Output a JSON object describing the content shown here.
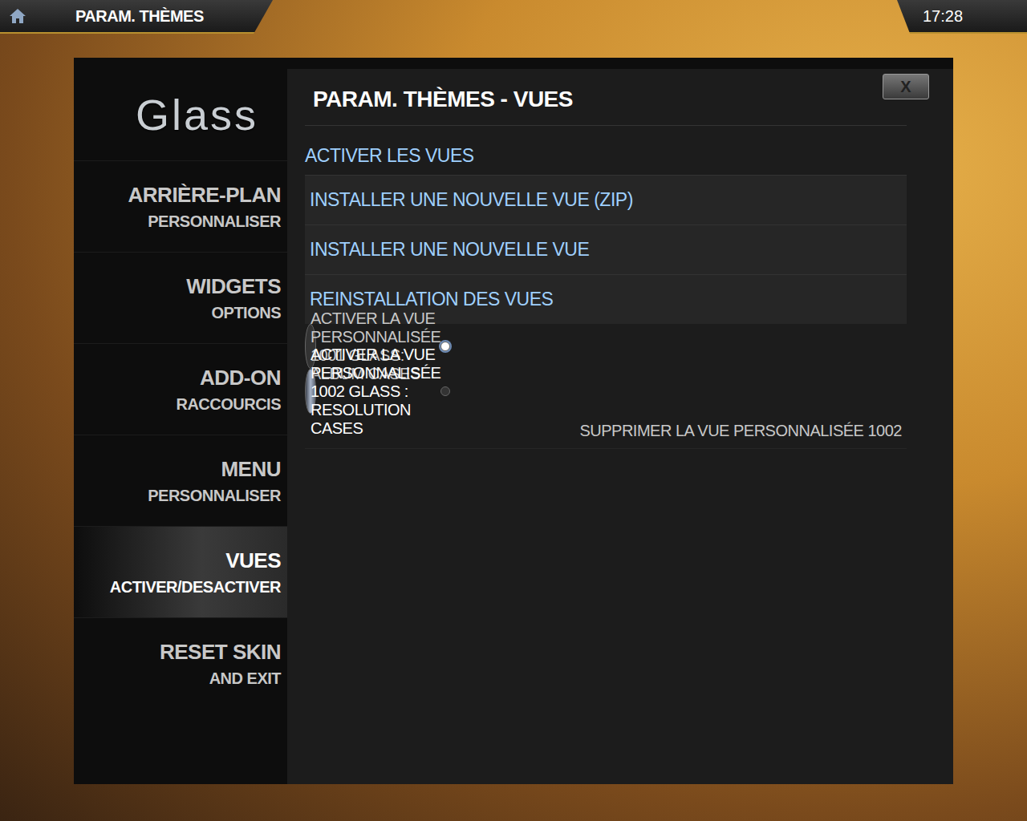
{
  "header": {
    "title": "PARAM. THÈMES",
    "clock": "17:28"
  },
  "dialog": {
    "logo": "Glass",
    "title": "PARAM. THÈMES - VUES",
    "close": "X"
  },
  "sidebar": {
    "items": [
      {
        "label": "ARRIÈRE-PLAN",
        "sub": "PERSONNALISER",
        "selected": false
      },
      {
        "label": "WIDGETS",
        "sub": "OPTIONS",
        "selected": false
      },
      {
        "label": "ADD-ON",
        "sub": "RACCOURCIS",
        "selected": false
      },
      {
        "label": "MENU",
        "sub": "PERSONNALISER",
        "selected": false
      },
      {
        "label": "VUES",
        "sub": "ACTIVER/DESACTIVER",
        "selected": true
      },
      {
        "label": "RESET SKIN",
        "sub": "AND EXIT",
        "selected": false
      }
    ]
  },
  "section": "ACTIVER LES VUES",
  "actions": [
    "INSTALLER UNE NOUVELLE VUE (ZIP)",
    "INSTALLER UNE NOUVELLE VUE",
    "REINSTALLATION DES VUES"
  ],
  "options": [
    {
      "label": "ACTIVER LA VUE PERSONNALISÉE 1001 GLASS: ALBUM CASES",
      "kind": "radio",
      "on": true,
      "selected": false
    },
    {
      "label": "ACTIVER LA VUE PERSONNALISÉE 1002 GLASS : RESOLUTION CASES",
      "kind": "radio",
      "on": false,
      "selected": true
    },
    {
      "label": "SUPPRIMER LA VUE PERSONNALISÉE 1002",
      "kind": "button",
      "selected": false
    }
  ]
}
